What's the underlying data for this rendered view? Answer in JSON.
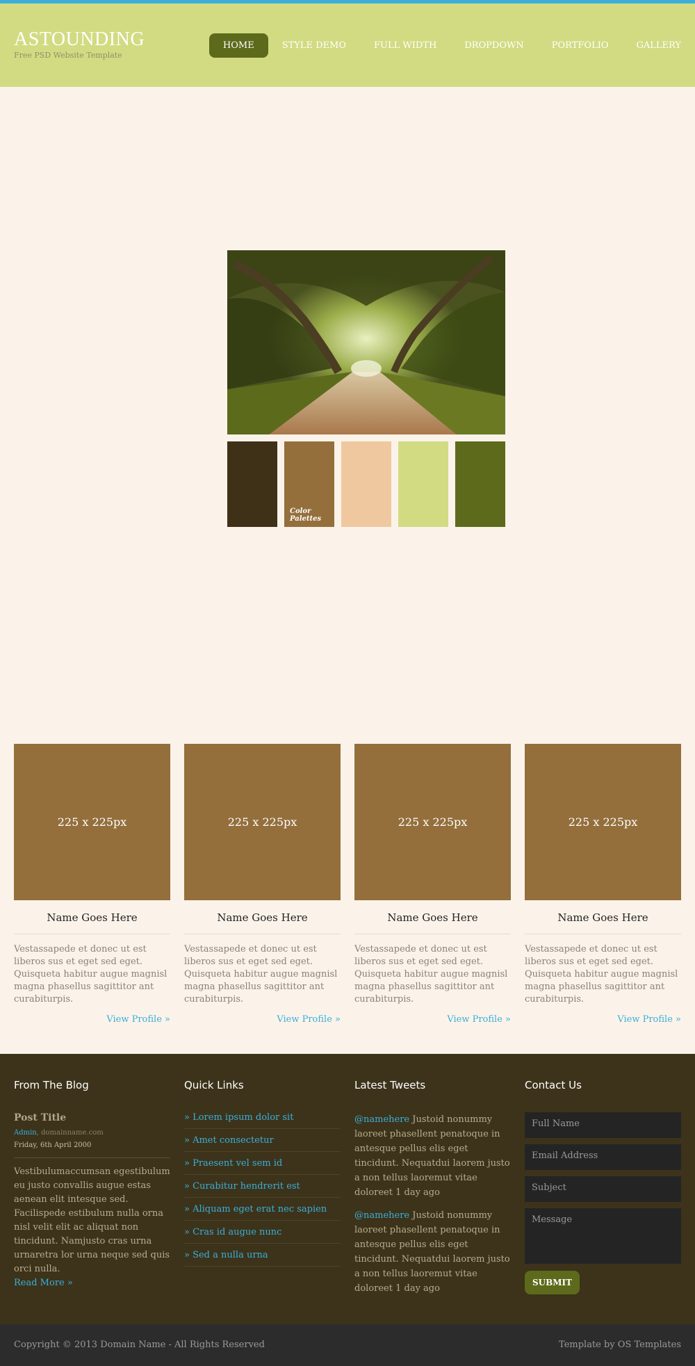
{
  "header": {
    "logo_title": "ASTOUNDING",
    "logo_subtitle": "Free PSD Website Template",
    "nav": [
      {
        "label": "HOME",
        "active": true
      },
      {
        "label": "STYLE DEMO"
      },
      {
        "label": "FULL WIDTH"
      },
      {
        "label": "DROPDOWN"
      },
      {
        "label": "PORTFOLIO"
      },
      {
        "label": "GALLERY"
      }
    ]
  },
  "hero": {
    "palette_label": "Color\nPalettes",
    "palette_colors": [
      "#3F3117",
      "#946F3C",
      "#EFC89F",
      "#D2DB81",
      "#5D6A1B"
    ]
  },
  "team": {
    "cards": [
      {
        "image_text": "225 x 225px",
        "name": "Name Goes Here",
        "text": "Vestassapede et donec ut est liberos sus et eget sed eget. Quisqueta habitur augue magnisl magna phasellus sagittitor ant curabiturpis.",
        "link": "View Profile »"
      },
      {
        "image_text": "225 x 225px",
        "name": "Name Goes Here",
        "text": "Vestassapede et donec ut est liberos sus et eget sed eget. Quisqueta habitur augue magnisl magna phasellus sagittitor ant curabiturpis.",
        "link": "View Profile »"
      },
      {
        "image_text": "225 x 225px",
        "name": "Name Goes Here",
        "text": "Vestassapede et donec ut est liberos sus et eget sed eget. Quisqueta habitur augue magnisl magna phasellus sagittitor ant curabiturpis.",
        "link": "View Profile »"
      },
      {
        "image_text": "225 x 225px",
        "name": "Name Goes Here",
        "text": "Vestassapede et donec ut est liberos sus et eget sed eget. Quisqueta habitur augue magnisl magna phasellus sagittitor ant curabiturpis.",
        "link": "View Profile »"
      }
    ]
  },
  "footer": {
    "blog": {
      "title": "From The Blog",
      "post_title": "Post Title",
      "author": "Admin",
      "domain": ", domainname.com",
      "date": "Friday, 6th April 2000",
      "body": "Vestibulumaccumsan egestibulum eu justo convallis augue estas aenean elit intesque sed. Facilispede estibulum nulla orna nisl velit elit ac aliquat non tincidunt. Namjusto cras urna urnaretra lor urna neque sed quis orci nulla.",
      "read_more": "Read More »"
    },
    "quick_links": {
      "title": "Quick Links",
      "items": [
        "» Lorem ipsum dolor sit",
        "» Amet consectetur",
        "» Praesent vel sem id",
        "» Curabitur hendrerit est",
        "» Aliquam eget erat nec sapien",
        "» Cras id augue nunc",
        "» Sed a nulla urna"
      ]
    },
    "tweets": {
      "title": "Latest Tweets",
      "items": [
        {
          "handle": "@namehere",
          "text": " Justoid nonummy laoreet phasellent penatoque in antesque pellus elis eget tincidunt. Nequatdui laorem justo a non tellus laoremut vitae doloreet 1 day ago"
        },
        {
          "handle": "@namehere",
          "text": " Justoid nonummy laoreet phasellent penatoque in antesque pellus elis eget tincidunt. Nequatdui laorem justo a non tellus laoremut vitae doloreet 1 day ago"
        }
      ]
    },
    "contact": {
      "title": "Contact Us",
      "name_placeholder": "Full Name",
      "email_placeholder": "Email Address",
      "subject_placeholder": "Subject",
      "message_placeholder": "Message",
      "submit": "SUBMIT"
    }
  },
  "bottom": {
    "copyright": "Copyright © 2013 Domain Name - All Rights Reserved",
    "credit": "Template by OS Templates"
  }
}
